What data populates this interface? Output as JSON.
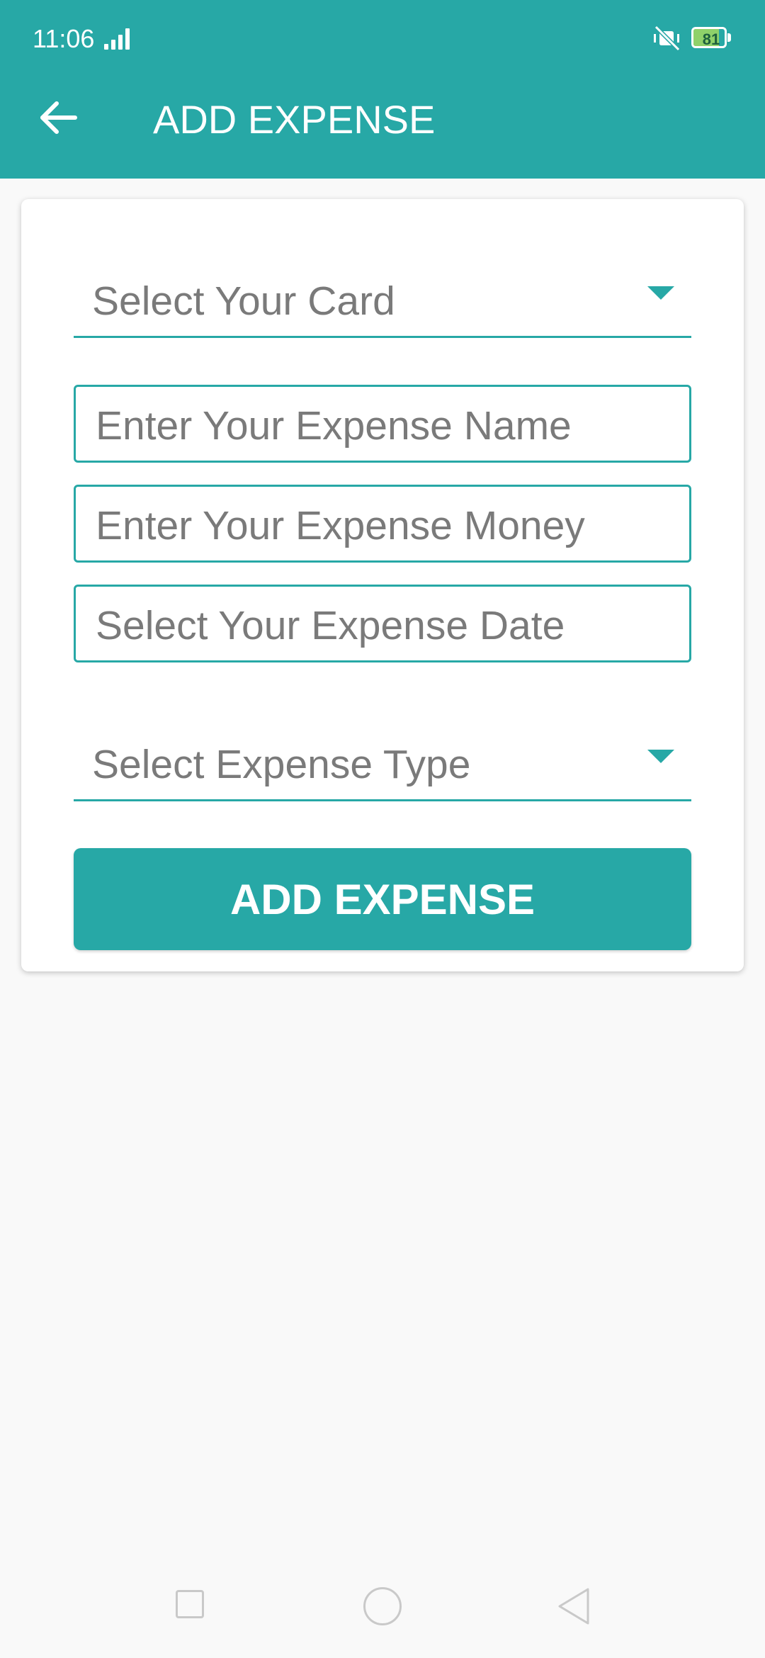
{
  "status_bar": {
    "time": "11:06",
    "battery_level": "81",
    "icons": [
      "signal-icon",
      "mute-vibrate-icon",
      "battery-icon"
    ]
  },
  "app_bar": {
    "title": "ADD EXPENSE",
    "back_icon": "arrow-left-icon"
  },
  "form": {
    "card_select": {
      "label": "Select Your Card",
      "icon": "dropdown-caret-icon"
    },
    "expense_name": {
      "placeholder": "Enter Your Expense Name"
    },
    "expense_money": {
      "placeholder": "Enter Your Expense Money"
    },
    "expense_date": {
      "placeholder": "Select Your Expense Date"
    },
    "expense_type_select": {
      "label": "Select Expense Type",
      "icon": "dropdown-caret-icon"
    },
    "submit_label": "ADD EXPENSE"
  },
  "nav_bar": {
    "icons": [
      "recents-icon",
      "home-icon",
      "back-icon"
    ]
  },
  "colors": {
    "primary": "#27a8a6",
    "background": "#f9f9f9",
    "placeholder": "#7a7a7a"
  }
}
